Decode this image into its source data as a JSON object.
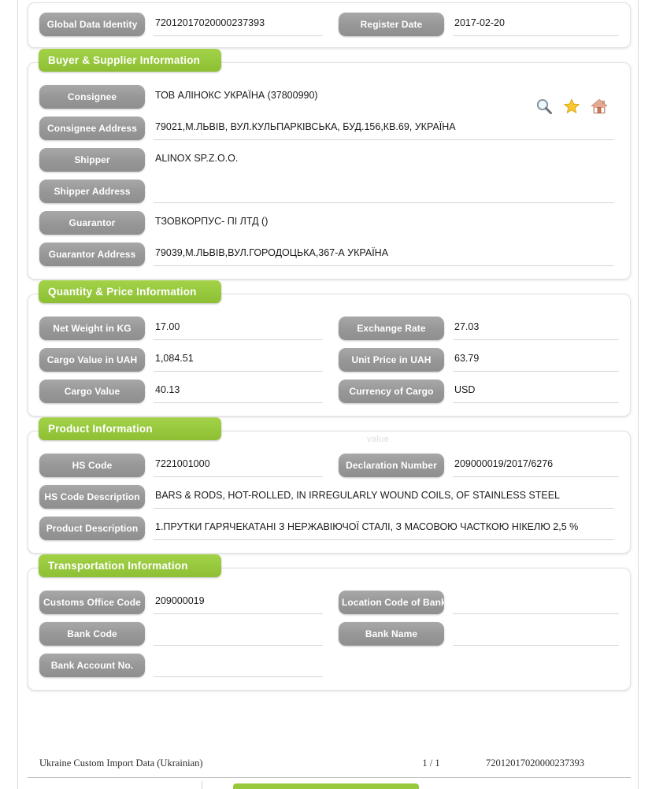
{
  "identity": {
    "global_data_identity_label": "Global Data Identity",
    "global_data_identity_value": "72012017020000237393",
    "register_date_label": "Register Date",
    "register_date_value": "2017-02-20"
  },
  "buyer_supplier": {
    "title": "Buyer & Supplier Information",
    "icons": [
      {
        "name": "search-icon",
        "title": "search"
      },
      {
        "name": "favorite-star-icon",
        "title": "favorite"
      },
      {
        "name": "home-icon",
        "title": "home"
      }
    ],
    "fields": [
      {
        "label": "Consignee",
        "value": "ТОВ АЛІНОКС УКРАЇНА (37800990)"
      },
      {
        "label": "Consignee Address",
        "value": "79021,М.ЛЬВІВ, ВУЛ.КУЛЬПАРКІВСЬКА, БУД.156,КВ.69, УКРАЇНА"
      },
      {
        "label": "Shipper",
        "value": "ALINOX SP.Z.O.O."
      },
      {
        "label": "Shipper Address",
        "value": ""
      },
      {
        "label": "Guarantor",
        "value": "ТЗОВКОРПУС- ПІ ЛТД ()"
      },
      {
        "label": "Guarantor Address",
        "value": "79039,М.ЛЬВІВ,ВУЛ.ГОРОДОЦЬКА,367-А УКРАЇНА"
      }
    ]
  },
  "quantity_price": {
    "title": "Quantity & Price Information",
    "left": [
      {
        "label": "Net Weight in KG",
        "value": "17.00"
      },
      {
        "label": "Cargo Value in UAH",
        "value": "1,084.51"
      },
      {
        "label": "Cargo Value",
        "value": "40.13"
      }
    ],
    "right": [
      {
        "label": "Exchange Rate",
        "value": "27.03"
      },
      {
        "label": "Unit Price in UAH",
        "value": "63.79"
      },
      {
        "label": "Currency of Cargo",
        "value": "USD"
      }
    ],
    "ghost_text": "value"
  },
  "product": {
    "title": "Product Information",
    "hs_code_label": "HS Code",
    "hs_code_value": "7221001000",
    "declaration_number_label": "Declaration Number",
    "declaration_number_value": "209000019/2017/6276",
    "hs_code_description_label": "HS Code Description",
    "hs_code_description_value": "BARS & RODS, HOT-ROLLED, IN IRREGULARLY WOUND COILS, OF STAINLESS STEEL",
    "product_description_label": "Product Description",
    "product_description_value": "1.ПРУТКИ ГАРЯЧЕКАТАНІ З НЕРЖАВІЮЧОЇ СТАЛІ, З МАСОВОЮ ЧАСТКОЮ НІКЕЛЮ 2,5 %"
  },
  "transportation": {
    "title": "Transportation Information",
    "left": [
      {
        "label": "Customs Office Code",
        "value": "209000019"
      },
      {
        "label": "Bank Code",
        "value": ""
      },
      {
        "label": "Bank Account No.",
        "value": ""
      }
    ],
    "right": [
      {
        "label": "Location Code of Bank",
        "value": ""
      },
      {
        "label": "Bank Name",
        "value": ""
      }
    ]
  },
  "footer": {
    "source": "Ukraine Custom Import Data (Ukrainian)",
    "page": "1 / 1",
    "identity": "72012017020000237393"
  },
  "colors": {
    "section_green": "#97c93d",
    "label_gray": "#9e9e9e",
    "star_gold": "#f5c518"
  }
}
